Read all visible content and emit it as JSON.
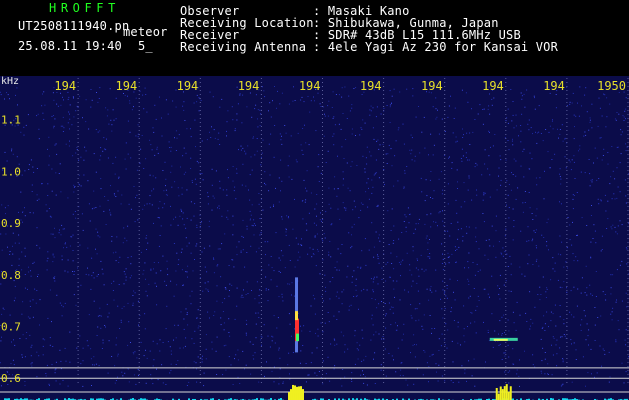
{
  "app_title": "HROFFT",
  "file_name": "UT2508111940.pn",
  "mode_label": "meteor",
  "datetime": "25.08.11 19:40",
  "sequence": "5_",
  "info": [
    {
      "key": "Observer",
      "value": ": Masaki Kano"
    },
    {
      "key": "Receiving Location",
      "value": ": Shibukawa, Gunma, Japan"
    },
    {
      "key": "Receiver",
      "value": ": SDR# 43dB L15 111.6MHz USB"
    },
    {
      "key": "Receiving Antenna",
      "value": ": 4ele Yagi Az 230 for Kansai VOR"
    }
  ],
  "chart_data": {
    "type": "heatmap",
    "ylabel": "kHz",
    "x_tick_labels": [
      "194",
      "194",
      "194",
      "194",
      "194",
      "194",
      "194",
      "194",
      "194",
      "1950"
    ],
    "y_tick_labels": [
      "1.1",
      "1.0",
      "0.9",
      "0.8",
      "0.7",
      "0.6"
    ],
    "y_ticks": [
      1.1,
      1.0,
      0.9,
      0.8,
      0.7,
      0.6
    ],
    "ylim": [
      0.585,
      1.165
    ],
    "x_tick_positions": [
      0.1,
      0.2,
      0.3,
      0.4,
      0.5,
      0.6,
      0.7,
      0.8,
      0.9,
      1.0
    ],
    "vertical_gridlines": true,
    "events": [
      {
        "name": "meteor-echo",
        "t": 0.455,
        "f_min": 0.65,
        "f_max": 0.795
      },
      {
        "name": "meteor-echo",
        "t": 0.795,
        "f_min": 0.66,
        "f_max": 0.68
      }
    ],
    "colors": {
      "background": "#0b0c4a",
      "noise": "#2a37c8",
      "grid": "#d8d8d8",
      "signal_strip": "#12d8f0",
      "axis_text": "#e8e02a"
    }
  }
}
